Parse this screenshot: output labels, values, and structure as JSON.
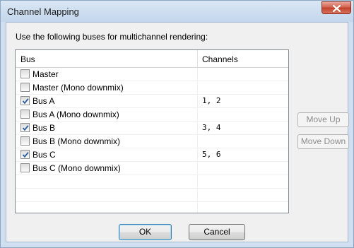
{
  "window": {
    "title": "Channel Mapping"
  },
  "instruction": "Use the following buses for multichannel rendering:",
  "table": {
    "columns": [
      "Bus",
      "Channels"
    ],
    "rows": [
      {
        "label": "Master",
        "channels": "",
        "checked": false
      },
      {
        "label": "Master (Mono downmix)",
        "channels": "",
        "checked": false
      },
      {
        "label": "Bus A",
        "channels": "1, 2",
        "checked": true
      },
      {
        "label": "Bus A (Mono downmix)",
        "channels": "",
        "checked": false
      },
      {
        "label": "Bus B",
        "channels": "3, 4",
        "checked": true
      },
      {
        "label": "Bus B (Mono downmix)",
        "channels": "",
        "checked": false
      },
      {
        "label": "Bus C",
        "channels": "5, 6",
        "checked": true
      },
      {
        "label": "Bus C (Mono downmix)",
        "channels": "",
        "checked": false
      }
    ]
  },
  "side_buttons": {
    "move_up": "Move Up",
    "move_down": "Move Down"
  },
  "buttons": {
    "ok": "OK",
    "cancel": "Cancel"
  },
  "colors": {
    "titlebar": "#c3d6eb",
    "close": "#c1412b",
    "client": "#f0f0f0"
  },
  "icons": {
    "close": "close-icon",
    "check": "check-icon"
  }
}
